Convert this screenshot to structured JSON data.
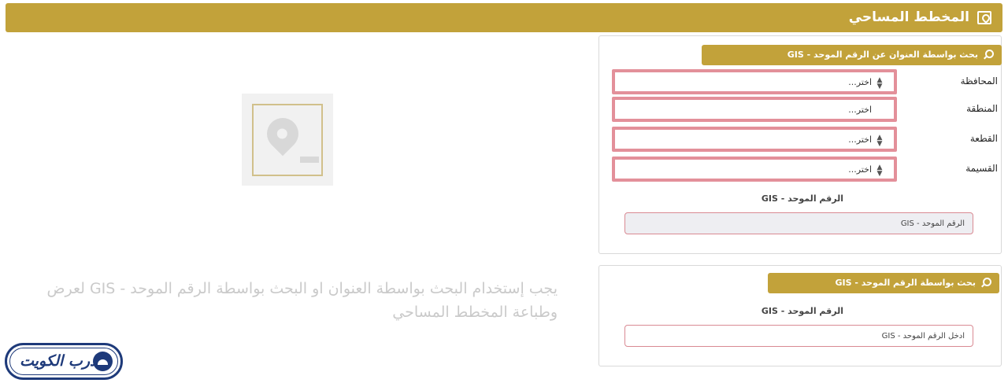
{
  "header": {
    "title": "المخطط المساحي",
    "icon": "map-pin-square-icon"
  },
  "address_search": {
    "heading": "بحث بواسطة العنوان عن الرقم الموحد - GIS",
    "fields": [
      {
        "label": "المحافظة",
        "value": "اختر..."
      },
      {
        "label": "المنطقة",
        "value": "اختر..."
      },
      {
        "label": "القطعة",
        "value": "اختر..."
      },
      {
        "label": "القسيمة",
        "value": "اختر..."
      }
    ],
    "gis_label": "الرقم الموحد - GIS",
    "gis_placeholder": "الرقم الموحد - GIS"
  },
  "gis_search": {
    "heading": "بحث بواسطة الرقم الموحد - GIS",
    "gis_label": "الرقم الموحد - GIS",
    "gis_placeholder": "ادخل الرقم الموحد - GIS"
  },
  "hint": "يجب إستخدام البحث بواسطة العنوان او البحث بواسطة الرقم الموحد - GIS لعرض وطباعة المخطط المساحي",
  "brand": {
    "name": "درب الكويت"
  },
  "colors": {
    "accent": "#c2a23a",
    "error_border": "#e3909a",
    "brand": "#1e3a7a"
  }
}
